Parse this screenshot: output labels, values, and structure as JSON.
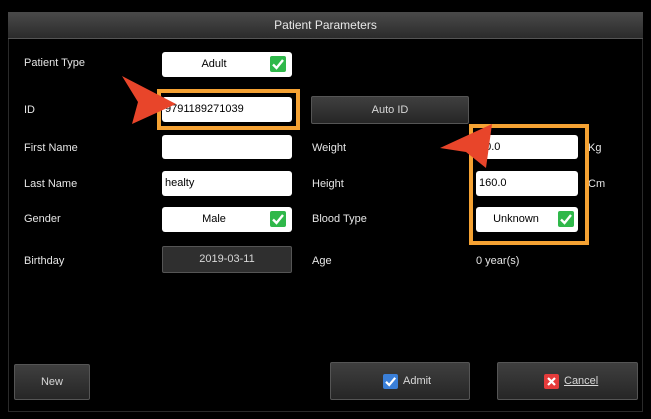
{
  "dialog": {
    "title": "Patient Parameters"
  },
  "labels": {
    "patient_type": "Patient Type",
    "id": "ID",
    "first_name": "First Name",
    "last_name": "Last Name",
    "gender": "Gender",
    "birthday": "Birthday",
    "weight": "Weight",
    "height": "Height",
    "blood_type": "Blood Type",
    "age": "Age"
  },
  "fields": {
    "patient_type": "Adult",
    "id": "9791189271039",
    "first_name": "",
    "last_name": "healty",
    "gender": "Male",
    "birthday": "2019-03-11",
    "weight": "60.0",
    "height": "160.0",
    "blood_type": "Unknown",
    "age": "0 year(s)"
  },
  "units": {
    "weight": "Kg",
    "height": "Cm"
  },
  "buttons": {
    "auto_id": "Auto ID",
    "new": "New",
    "admit": "Admit",
    "cancel": "Cancel"
  },
  "colors": {
    "highlight": "#f5a233",
    "arrow": "#e8452a",
    "check_green": "#2fb84a",
    "admit_blue": "#3a7fd8",
    "cancel_red": "#e53b3b"
  },
  "icons": {
    "checkmark": "checkmark-icon",
    "admit": "admit-check-icon",
    "cancel": "cancel-x-icon"
  }
}
